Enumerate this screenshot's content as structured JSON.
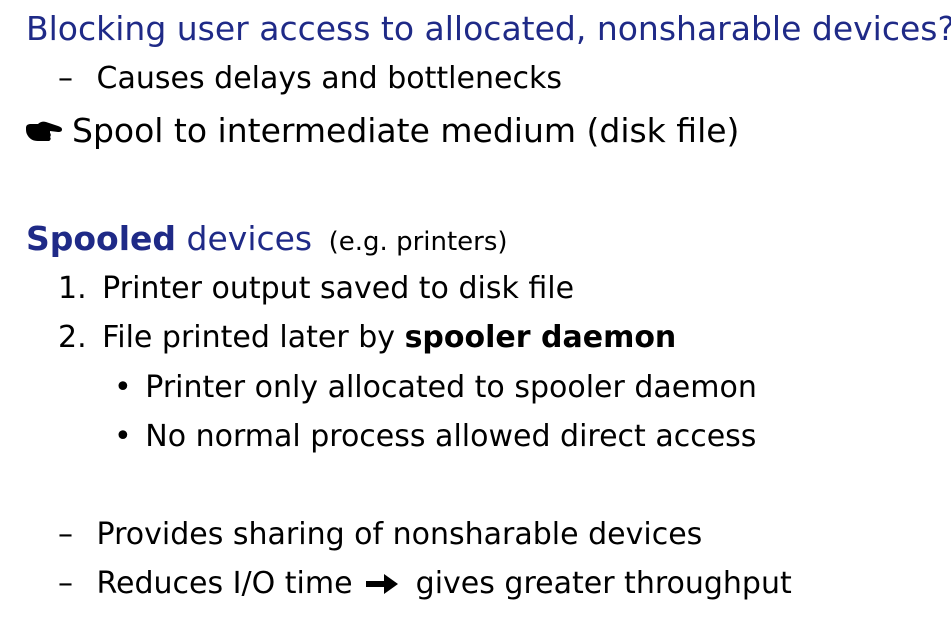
{
  "slide": {
    "heading1": "Blocking user access to allocated, nonsharable devices?",
    "dash1": "–",
    "dash1_text": "Causes delays and bottlenecks",
    "pointer_text": "Spool to intermediate medium (disk file)",
    "heading2_bold": "Spooled",
    "heading2_rest": " devices",
    "heading2_note": "(e.g. printers)",
    "num1": "1.",
    "num1_text": "Printer output saved to disk file",
    "num2": "2.",
    "num2_text_plain": "File printed later by ",
    "num2_text_bold": "spooler daemon",
    "bullet": "•",
    "sub1_text": "Printer only allocated to spooler daemon",
    "sub2_text": "No normal process allowed direct access",
    "dash2": "–",
    "dash2_text": "Provides sharing of nonsharable devices",
    "dash3": "–",
    "dash3_text_a": "Reduces I/O time",
    "dash3_text_b": "gives greater throughput"
  },
  "colors": {
    "heading": "#1f2a87",
    "body": "#000000"
  },
  "icons": {
    "pointer": "pointing-hand-icon",
    "arrow": "right-arrow-icon"
  }
}
